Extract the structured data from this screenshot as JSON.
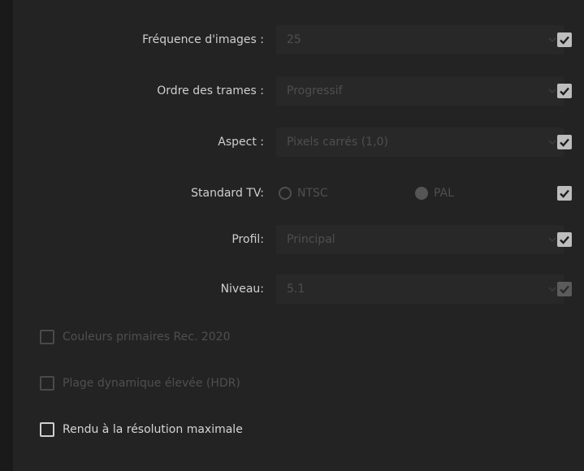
{
  "settings": {
    "frame_rate": {
      "label": "Fréquence d'images :",
      "value": "25",
      "linked": true
    },
    "field_order": {
      "label": "Ordre des trames :",
      "value": "Progressif",
      "linked": true
    },
    "aspect": {
      "label": "Aspect :",
      "value": "Pixels carrés (1,0)",
      "linked": true
    },
    "tv_standard": {
      "label": "Standard TV:",
      "options": [
        {
          "label": "NTSC",
          "selected": false
        },
        {
          "label": "PAL",
          "selected": true
        }
      ],
      "linked": true
    },
    "profile": {
      "label": "Profil:",
      "value": "Principal",
      "linked": true
    },
    "level": {
      "label": "Niveau:",
      "value": "5.1",
      "linked": true
    }
  },
  "options": {
    "rec2020": {
      "label": "Couleurs primaires Rec. 2020",
      "checked": false,
      "enabled": false
    },
    "hdr": {
      "label": "Plage dynamique élevée (HDR)",
      "checked": false,
      "enabled": false
    },
    "max_render": {
      "label": "Rendu à la résolution maximale",
      "checked": false,
      "enabled": true
    }
  },
  "colors": {
    "panel_bg": "#232323",
    "field_bg": "#282828",
    "label_text": "#cfcfcf",
    "disabled_text": "#4f4f4f",
    "checkbox_checked": "#bdbdbd"
  }
}
